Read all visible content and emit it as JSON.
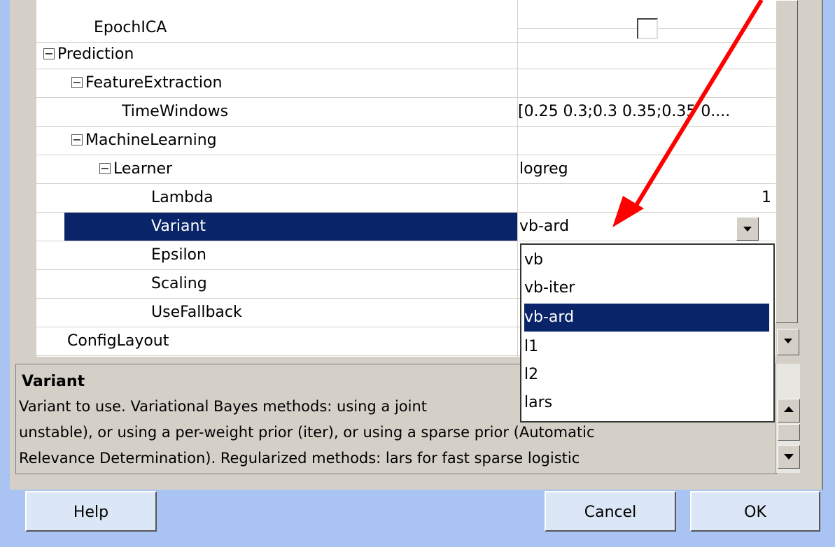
{
  "grid": {
    "rows": [
      {
        "name": "EpochICA",
        "value": ""
      },
      {
        "name": "Prediction",
        "toggle": "⊟",
        "value": ""
      },
      {
        "name": "FeatureExtraction",
        "toggle": "⊟",
        "value": ""
      },
      {
        "name": "TimeWindows",
        "value": "[0.25 0.3;0.3 0.35;0.35 0...."
      },
      {
        "name": "MachineLearning",
        "toggle": "⊟",
        "value": ""
      },
      {
        "name": "Learner",
        "toggle": "⊟",
        "value": "logreg"
      },
      {
        "name": "Lambda",
        "value": "1"
      },
      {
        "name": "Variant",
        "value": "vb-ard"
      },
      {
        "name": "Epsilon",
        "value": ""
      },
      {
        "name": "Scaling",
        "value": ""
      },
      {
        "name": "UseFallback",
        "value": ""
      },
      {
        "name": "ConfigLayout",
        "value": ""
      }
    ],
    "selected_row": "Variant"
  },
  "dropdown": {
    "options": [
      "vb",
      "vb-iter",
      "vb-ard",
      "l1",
      "l2",
      "lars"
    ],
    "selected": "vb-ard"
  },
  "help": {
    "title": "Variant",
    "text": "Variant to use.  Variational Bayes methods: using a joint",
    "line2": "unstable), or using a per-weight prior (iter), or using a sparse prior (Automatic",
    "line3": "Relevance Determination). Regularized methods: lars for fast sparse logistic"
  },
  "buttons": {
    "help": "Help",
    "cancel": "Cancel",
    "ok": "OK"
  },
  "colors": {
    "selection": "#0a246a",
    "annotation_arrow": "#ff0000",
    "background": "#a9c3f2"
  }
}
